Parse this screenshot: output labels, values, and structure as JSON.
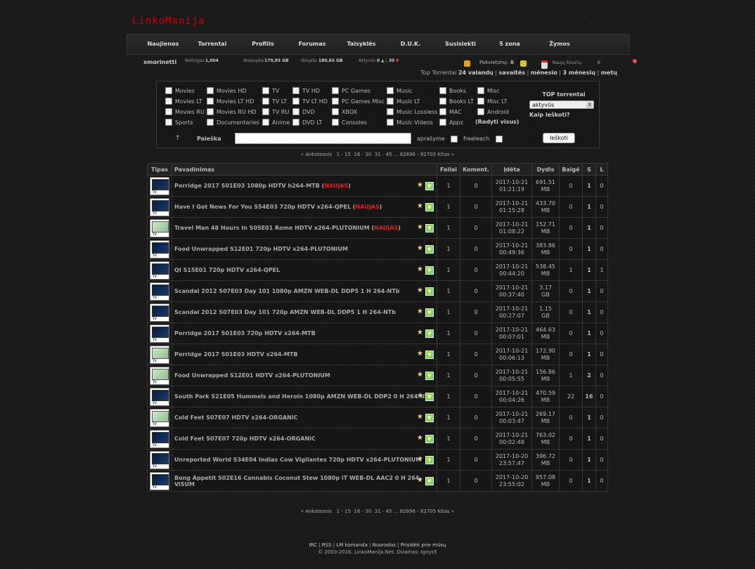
{
  "site": {
    "logo": "LinkoManija"
  },
  "nav": [
    {
      "label": "Naujienos"
    },
    {
      "label": "Torrentai"
    },
    {
      "label": "Profilis"
    },
    {
      "label": "Forumas"
    },
    {
      "label": "Taisyklės"
    },
    {
      "label": "D.U.K."
    },
    {
      "label": "Susisiekti"
    },
    {
      "label": "5 zona"
    },
    {
      "label": "Žymos"
    }
  ],
  "userbar": {
    "username": "xmorinetti",
    "rating_label": "Reitingas",
    "rating_value": "1,004",
    "uploaded_label": "Atsisiųsta",
    "uploaded_value": "179,95 GB",
    "downloaded_label": "Išsiųsta",
    "downloaded_value": "180,65 GB",
    "active_label": "Aktyvūs",
    "active_seed": "0",
    "active_leech": "30",
    "invites_label": "Pakvietimų:",
    "invites_value": "0",
    "new_messages_label": "Naujų žinučių:",
    "new_messages_value": "0"
  },
  "top_torrents_links": {
    "prefix": "Top Torrentai",
    "l1": "24 valandų",
    "l2": "savaitės",
    "l3": "mėnesio",
    "l4": "3 mėnesių",
    "l5": "metų"
  },
  "categories": [
    "Movies",
    "Movies HD",
    "TV",
    "TV HD",
    "PC Games",
    "Music",
    "Books",
    "Misc",
    "Movies LT",
    "Movies LT HD",
    "TV LT",
    "TV LT HD",
    "PC Games Misc",
    "Music LT",
    "Books LT",
    "Misc LT",
    "Movies RU",
    "Movies RU HD",
    "TV RU",
    "DVD",
    "XBOX",
    "Music Lossless",
    "MAC",
    "Android",
    "Sports",
    "Documentaries",
    "Anime",
    "DVD LT",
    "Consoles",
    "Music Videos",
    "Appz"
  ],
  "show_all": "(Rodyti visus)",
  "top_box": {
    "title": "TOP torrentai",
    "select_value": "aktyvūs",
    "how_to": "Kaip ieškoti?"
  },
  "search": {
    "label": "Paieška",
    "up_arrow": "↑",
    "desc_label": "aprašyme",
    "freeleech_label": "freeleech",
    "button": "Ieškoti"
  },
  "pager": {
    "prev": "« Ankstesnis",
    "p1": "1 - 15",
    "p2": "16 - 30",
    "p3": "31 - 45",
    "dots": "...",
    "p4": "82696 - 82705",
    "next": "Kitas »"
  },
  "table": {
    "headers": {
      "type": "Tipas",
      "name": "Pavadinimas",
      "files": "Failai",
      "comments": "Koment.",
      "added": "Įdėta",
      "size": "Dydis",
      "snatched": "Baigė",
      "seeders": "S",
      "leechers": "L"
    },
    "new_tag": "NAUJAS",
    "rows": [
      {
        "icon": "hd",
        "name": "Porridge 2017 S01E03 1080p HDTV h264-MTB",
        "new": true,
        "files": "1",
        "comments": "0",
        "date": "2017-10-21",
        "time": "01:21:19",
        "size_num": "691.51",
        "size_unit": "MB",
        "snatched": "0",
        "seeders": "1",
        "leechers": "0"
      },
      {
        "icon": "hd",
        "name": "Have I Got News For You S54E03 720p HDTV x264-QPEL",
        "new": true,
        "files": "1",
        "comments": "0",
        "date": "2017-10-21",
        "time": "01:15:28",
        "size_num": "433.70",
        "size_unit": "MB",
        "snatched": "0",
        "seeders": "1",
        "leechers": "0"
      },
      {
        "icon": "sd",
        "name": "Travel Man 48 Hours In S05E01 Rome HDTV x264-PLUTONIUM",
        "new": true,
        "files": "1",
        "comments": "0",
        "date": "2017-10-21",
        "time": "01:08:22",
        "size_num": "152.71",
        "size_unit": "MB",
        "snatched": "0",
        "seeders": "1",
        "leechers": "0"
      },
      {
        "icon": "hd",
        "name": "Food Unwrapped S12E01 720p HDTV x264-PLUTONIUM",
        "new": false,
        "files": "1",
        "comments": "0",
        "date": "2017-10-21",
        "time": "00:49:36",
        "size_num": "383.86",
        "size_unit": "MB",
        "snatched": "0",
        "seeders": "1",
        "leechers": "0"
      },
      {
        "icon": "hd",
        "name": "QI S15E01 720p HDTV x264-QPEL",
        "new": false,
        "files": "1",
        "comments": "0",
        "date": "2017-10-21",
        "time": "00:44:20",
        "size_num": "538.45",
        "size_unit": "MB",
        "snatched": "1",
        "seeders": "1",
        "leechers": "1"
      },
      {
        "icon": "hd",
        "name": "Scandal 2012 S07E03 Day 101 1080p AMZN WEB-DL DDP5 1 H 264-NTb",
        "new": false,
        "files": "1",
        "comments": "0",
        "date": "2017-10-21",
        "time": "00:37:40",
        "size_num": "3.17",
        "size_unit": "GB",
        "snatched": "0",
        "seeders": "1",
        "leechers": "0"
      },
      {
        "icon": "hd",
        "name": "Scandal 2012 S07E03 Day 101 720p AMZN WEB-DL DDP5 1 H 264-NTb",
        "new": false,
        "files": "1",
        "comments": "0",
        "date": "2017-10-21",
        "time": "00:27:07",
        "size_num": "1.15",
        "size_unit": "GB",
        "snatched": "0",
        "seeders": "1",
        "leechers": "0"
      },
      {
        "icon": "hd",
        "name": "Porridge 2017 S01E03 720p HDTV x264-MTB",
        "new": false,
        "files": "1",
        "comments": "0",
        "date": "2017-10-21",
        "time": "00:07:01",
        "size_num": "464.63",
        "size_unit": "MB",
        "snatched": "0",
        "seeders": "1",
        "leechers": "0"
      },
      {
        "icon": "sd",
        "name": "Porridge 2017 S01E03 HDTV x264-MTB",
        "new": false,
        "files": "1",
        "comments": "0",
        "date": "2017-10-21",
        "time": "00:06:13",
        "size_num": "172.90",
        "size_unit": "MB",
        "snatched": "0",
        "seeders": "1",
        "leechers": "0"
      },
      {
        "icon": "sd",
        "name": "Food Unwrapped S12E01 HDTV x264-PLUTONIUM",
        "new": false,
        "files": "1",
        "comments": "0",
        "date": "2017-10-21",
        "time": "00:05:55",
        "size_num": "156.86",
        "size_unit": "MB",
        "snatched": "1",
        "seeders": "2",
        "leechers": "0"
      },
      {
        "icon": "hd",
        "name": "South Park S21E05 Hummels and Heroin 1080p AMZN WEB-DL DDP2 0 H 264-NTb",
        "new": false,
        "files": "1",
        "comments": "0",
        "date": "2017-10-21",
        "time": "00:04:26",
        "size_num": "470.59",
        "size_unit": "MB",
        "snatched": "22",
        "seeders": "16",
        "leechers": "0"
      },
      {
        "icon": "sd",
        "name": "Cold Feet S07E07 HDTV x264-ORGANiC",
        "new": false,
        "files": "1",
        "comments": "0",
        "date": "2017-10-21",
        "time": "00:03:47",
        "size_num": "269.17",
        "size_unit": "MB",
        "snatched": "0",
        "seeders": "1",
        "leechers": "0"
      },
      {
        "icon": "hd",
        "name": "Cold Feet S07E07 720p HDTV x264-ORGANiC",
        "new": false,
        "files": "1",
        "comments": "0",
        "date": "2017-10-21",
        "time": "00:02:48",
        "size_num": "763.02",
        "size_unit": "MB",
        "snatched": "0",
        "seeders": "1",
        "leechers": "0"
      },
      {
        "icon": "hd",
        "name": "Unreported World S34E04 Indias Cow Vigilantes 720p HDTV x264-PLUTONIUM",
        "new": false,
        "files": "1",
        "comments": "0",
        "date": "2017-10-20",
        "time": "23:57:47",
        "size_num": "396.72",
        "size_unit": "MB",
        "snatched": "0",
        "seeders": "1",
        "leechers": "0"
      },
      {
        "icon": "hd",
        "name": "Bong Appetit S02E16 Cannabis Coconut Stew 1080p iT WEB-DL AAC2 0 H 264-ViSUM",
        "new": false,
        "files": "1",
        "comments": "0",
        "date": "2017-10-20",
        "time": "23:55:02",
        "size_num": "857.08",
        "size_unit": "MB",
        "snatched": "0",
        "seeders": "1",
        "leechers": "0"
      }
    ]
  },
  "footer": {
    "links": [
      "IRC",
      "RSS",
      "LM komanda",
      "Nuorodos",
      "Prisidėk prie mūsų"
    ],
    "copyright": "© 2003-2016, LinkoManija.Net. Dizainas: Ignys5"
  },
  "colors": {
    "accent": "#b01010",
    "new_tag": "#e02020",
    "download_icon": "#8cd04c"
  }
}
